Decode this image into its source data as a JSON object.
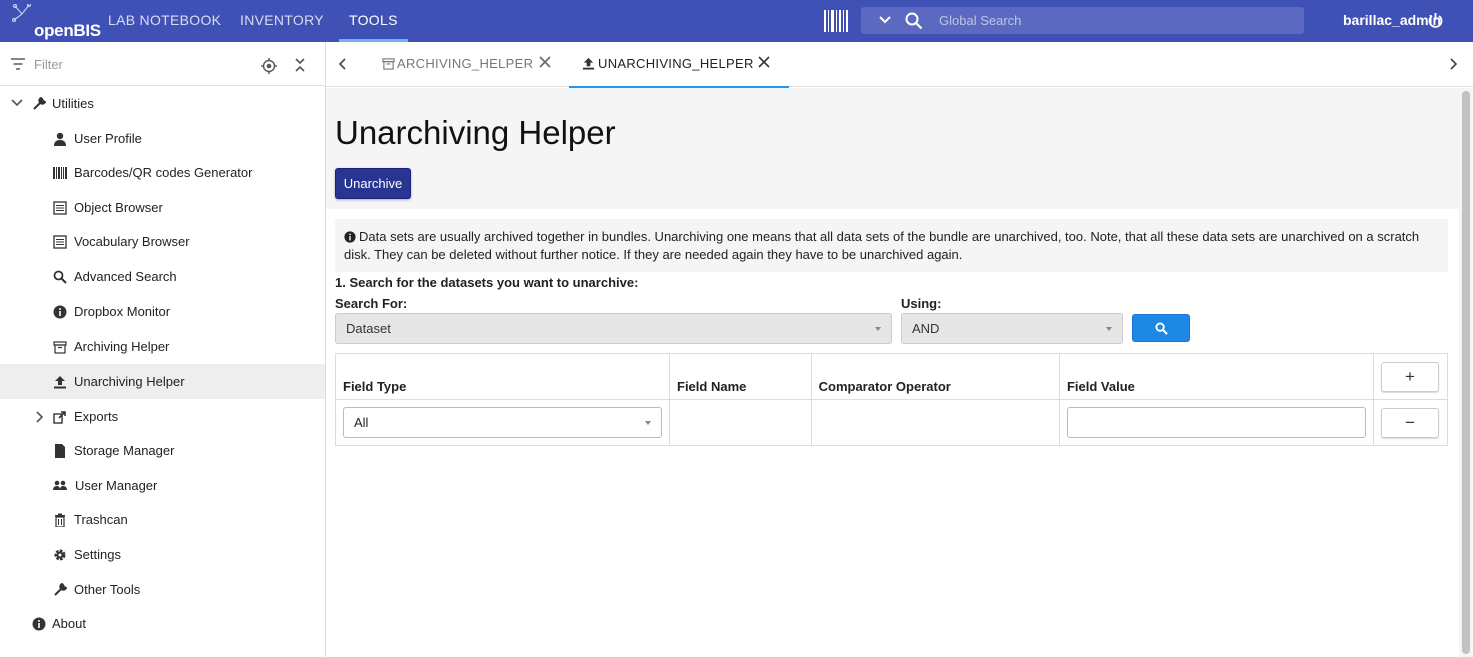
{
  "app": {
    "logo_text": "openBIS",
    "user": "barillac_admin"
  },
  "nav": [
    {
      "label": "LAB NOTEBOOK"
    },
    {
      "label": "INVENTORY"
    },
    {
      "label": "TOOLS"
    }
  ],
  "search": {
    "placeholder": "Global Search"
  },
  "sidebar": {
    "filter_placeholder": "Filter",
    "items": [
      {
        "label": "Utilities",
        "icon": "wrench-icon"
      },
      {
        "label": "User Profile",
        "icon": "person-icon"
      },
      {
        "label": "Barcodes/QR codes Generator",
        "icon": "barcode-icon"
      },
      {
        "label": "Object Browser",
        "icon": "list-icon"
      },
      {
        "label": "Vocabulary Browser",
        "icon": "list-icon"
      },
      {
        "label": "Advanced Search",
        "icon": "search-icon"
      },
      {
        "label": "Dropbox Monitor",
        "icon": "info-icon"
      },
      {
        "label": "Archiving Helper",
        "icon": "archive-icon"
      },
      {
        "label": "Unarchiving Helper",
        "icon": "upload-icon"
      },
      {
        "label": "Exports",
        "icon": "export-icon"
      },
      {
        "label": "Storage Manager",
        "icon": "file-icon"
      },
      {
        "label": "User Manager",
        "icon": "users-icon"
      },
      {
        "label": "Trashcan",
        "icon": "trash-icon"
      },
      {
        "label": "Settings",
        "icon": "gear-icon"
      },
      {
        "label": "Other Tools",
        "icon": "wrench-icon"
      },
      {
        "label": "About",
        "icon": "info-icon"
      }
    ]
  },
  "tabs": [
    {
      "label": "ARCHIVING_HELPER",
      "icon": "archive-icon"
    },
    {
      "label": "UNARCHIVING_HELPER",
      "icon": "upload-icon"
    }
  ],
  "page": {
    "title": "Unarchiving Helper",
    "unarchive_label": "Unarchive",
    "info_text": "Data sets are usually archived together in bundles. Unarchiving one means that all data sets of the bundle are unarchived, too. Note, that all these data sets are unarchived on a scratch disk. They can be deleted without further notice. If they are needed again they have to be unarchived again.",
    "section_title": "1. Search for the datasets you want to unarchive:",
    "search_for_label": "Search For:",
    "search_for_value": "Dataset",
    "using_label": "Using:",
    "using_value": "AND",
    "table": {
      "headers": [
        "Field Type",
        "Field Name",
        "Comparator Operator",
        "Field Value"
      ],
      "add_label": "+",
      "remove_label": "−",
      "row": {
        "field_type": "All",
        "field_value": ""
      }
    }
  },
  "colors": {
    "topbar": "#3f51b5",
    "primary_button": "#283593",
    "search_button": "#1e88e5",
    "tab_indicator": "#2196f3"
  }
}
